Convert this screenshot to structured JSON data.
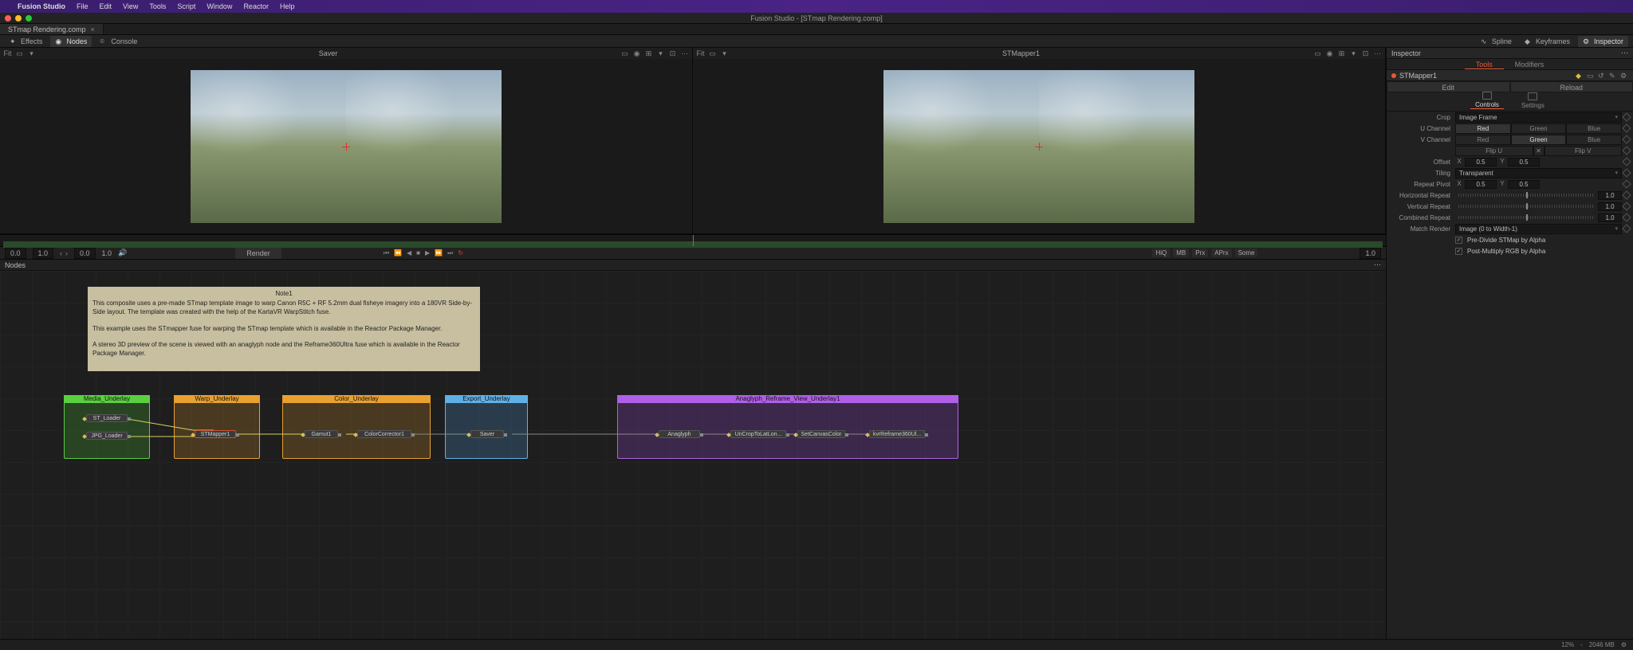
{
  "menubar": {
    "app": "Fusion Studio",
    "items": [
      "File",
      "Edit",
      "View",
      "Tools",
      "Script",
      "Window",
      "Reactor",
      "Help"
    ]
  },
  "window": {
    "title": "Fusion Studio - [STmap Rendering.comp]"
  },
  "tab": {
    "name": "STmap Rendering.comp"
  },
  "modes": {
    "effects": "Effects",
    "nodes": "Nodes",
    "console": "Console",
    "spline": "Spline",
    "keyframes": "Keyframes",
    "inspector": "Inspector"
  },
  "viewer1": {
    "title": "Saver",
    "fit": "Fit"
  },
  "viewer2": {
    "title": "STMapper1",
    "fit": "Fit"
  },
  "transport": {
    "start": "0.0",
    "out": "1.0",
    "current": "0.0",
    "end": "1.0",
    "render": "Render",
    "hiq": "HiQ",
    "mb": "MB",
    "prx": "Prx",
    "aprx": "APrx",
    "some": "Some",
    "frames": "1.0"
  },
  "inspector": {
    "title": "Inspector",
    "tabs": {
      "tools": "Tools",
      "modifiers": "Modifiers"
    },
    "node": "STMapper1",
    "edit": "Edit",
    "reload": "Reload",
    "subtabs": {
      "controls": "Controls",
      "settings": "Settings"
    },
    "crop_label": "Crop",
    "crop_value": "Image Frame",
    "uchan": "U Channel",
    "vchan": "V Channel",
    "red": "Red",
    "green": "Green",
    "blue": "Blue",
    "flipu": "Flip U",
    "flipv": "Flip V",
    "offset": "Offset",
    "offx": "0.5",
    "offy": "0.5",
    "tiling": "Tiling",
    "tiling_val": "Transparent",
    "repeat_pivot": "Repeat Pivot",
    "rpx": "0.5",
    "rpy": "0.5",
    "hrep": "Horizontal Repeat",
    "hrepv": "1.0",
    "vrep": "Vertical Repeat",
    "vrepv": "1.0",
    "crep": "Combined Repeat",
    "crepv": "1.0",
    "match": "Match Render",
    "match_val": "Image (0 to Width-1)",
    "predivide": "Pre-Divide STMap by Alpha",
    "postmult": "Post-Multiply RGB by Alpha"
  },
  "nodesbar": "Nodes",
  "note": {
    "title": "Note1",
    "line1": "This composite uses a pre-made STmap template image to warp Canon R5C + RF 5.2mm dual fisheye imagery into a 180VR Side-by-Side layout. The template was created with the help of the KartaVR WarpStitch fuse.",
    "line2": "This example uses the STmapper fuse for warping the STmap template which is available in the Reactor Package Manager.",
    "line3": "A stereo 3D preview of the scene is viewed with an anaglyph node and the Reframe360Ultra fuse which is available in the Reactor Package Manager."
  },
  "underlays": {
    "media": "Media_Underlay",
    "warp": "Warp_Underlay",
    "color": "Color_Underlay",
    "export": "Export_Underlay",
    "anaglyph": "Anaglyph_Reframe_View_Underlay1"
  },
  "nodes": {
    "st_loader": "ST_Loader",
    "jpg_loader": "JPG_Loader",
    "stmapper": "STMapper1",
    "gamut": "Gamut1",
    "cc": "ColorCorrector1",
    "saver": "Saver",
    "anaglyph": "Anaglyph",
    "uncrop": "UnCropToLatLon...",
    "setcanvas": "SetCanvasColor",
    "reframe": "kvrReframe360Ul..."
  },
  "status": {
    "pct": "12%",
    "mem": "2046 MB"
  }
}
